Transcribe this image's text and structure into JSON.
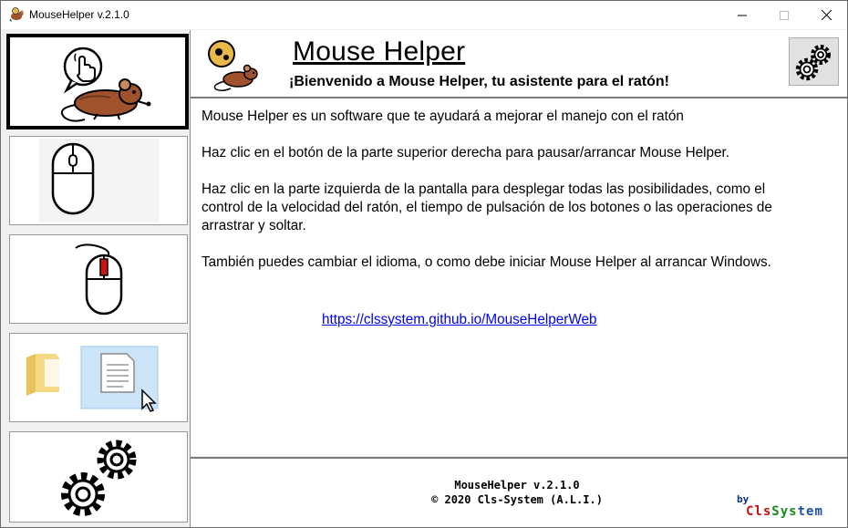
{
  "window": {
    "title": "MouseHelper v.2.1.0",
    "controls": [
      "minimize",
      "maximize",
      "close"
    ]
  },
  "sidebar": {
    "items": [
      {
        "id": "home",
        "icon": "mouse-pointer-hand-icon",
        "active": true
      },
      {
        "id": "mouse-speed",
        "icon": "mouse-wheel-icon",
        "active": false
      },
      {
        "id": "click-time",
        "icon": "mouse-left-click-icon",
        "active": false
      },
      {
        "id": "drag-drop",
        "icon": "drag-file-icon",
        "active": false
      },
      {
        "id": "settings",
        "icon": "gears-icon",
        "active": false
      }
    ]
  },
  "header": {
    "title": "Mouse Helper",
    "welcome": "¡Bienvenido a Mouse Helper, tu asistente para el ratón!",
    "settings_icon": "gears-icon"
  },
  "content": {
    "paragraphs": [
      "Mouse Helper es un software que te ayudará a mejorar el manejo con el ratón",
      "Haz clic en el botón de la parte superior derecha para pausar/arrancar Mouse Helper.",
      "Haz clic en la parte izquierda de la pantalla para desplegar todas las posibilidades, como el control de la velocidad del ratón, el tiempo de pulsación de los botones o las operaciones de arrastrar y soltar.",
      "También puedes cambiar el idioma, o como debe iniciar Mouse Helper al arrancar Windows."
    ],
    "link": "https://clssystem.github.io/MouseHelperWeb"
  },
  "footer": {
    "version": "MouseHelper v.2.1.0",
    "copyright": "©  2020 Cls-System (A.L.I.)",
    "by": "by",
    "brand_part1": "Cls",
    "brand_part2": "Sys",
    "brand_part3": "tem"
  },
  "colors": {
    "mouse_brown": "#a0522d",
    "gear_dark": "#1a1a1a",
    "link": "#0000ee",
    "brand_red": "#d01010",
    "brand_green": "#178a17",
    "brand_blue": "#1e4fb0"
  }
}
